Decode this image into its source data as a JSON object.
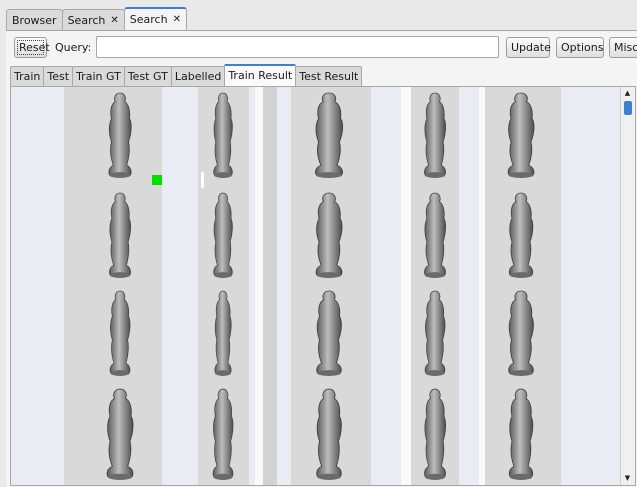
{
  "tabs": [
    {
      "label": "Browser",
      "closable": false
    },
    {
      "label": "Search",
      "closable": true
    },
    {
      "label": "Search",
      "closable": true,
      "active": true
    }
  ],
  "query": {
    "reset_label": "Reset",
    "label": "Query:",
    "value": "",
    "placeholder": "",
    "update_label": "Update",
    "options_label": "Options",
    "misc_label": "Misc"
  },
  "subtabs": [
    "Train",
    "Test",
    "Train GT",
    "Test GT",
    "Labelled",
    "Train Result",
    "Test Result"
  ],
  "active_subtab": "Train Result",
  "results": {
    "columns": 5,
    "rows_visible": 4,
    "thumbnail_subject": "statuette-3d-scan",
    "selection_marker_color": "#00e000"
  },
  "colors": {
    "accent": "#3d7fd0",
    "panel_bg": "#f4f4f4",
    "thumb_bg": "#d8d8d8",
    "statue": "#8a8a8a"
  }
}
